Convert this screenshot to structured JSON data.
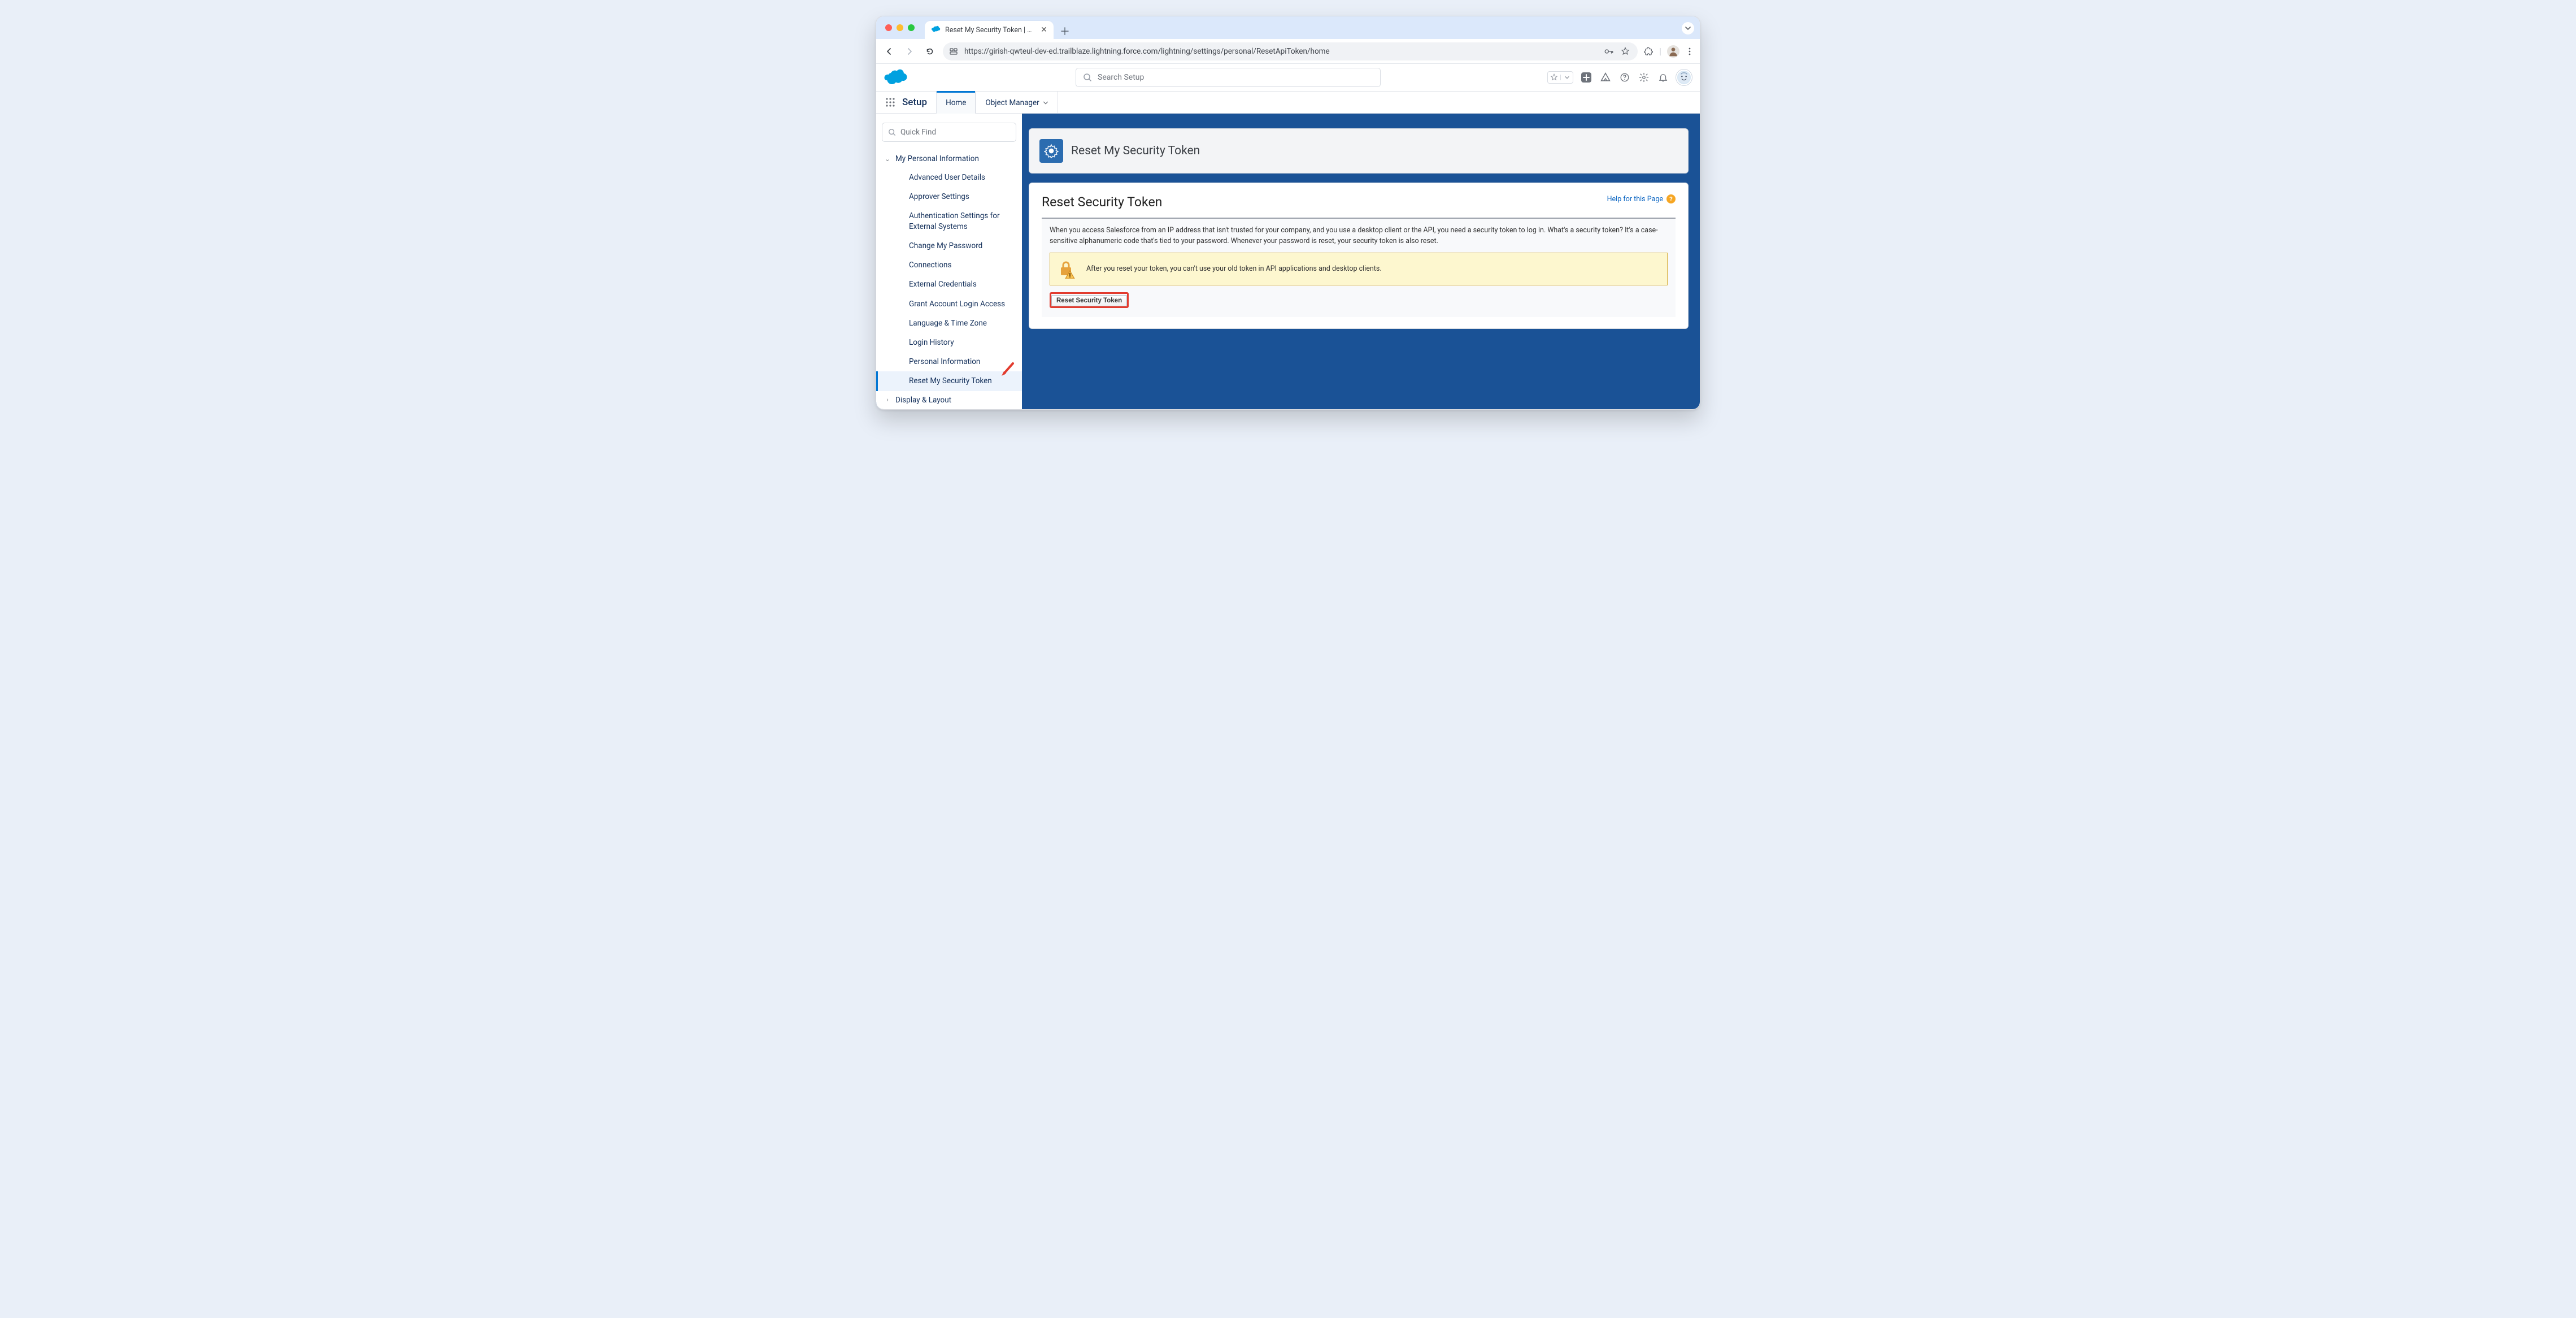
{
  "browser": {
    "tab_title": "Reset My Security Token | Sal",
    "url": "https://girish-qwteul-dev-ed.trailblaze.lightning.force.com/lightning/settings/personal/ResetApiToken/home"
  },
  "header": {
    "search_placeholder": "Search Setup"
  },
  "nav": {
    "app": "Setup",
    "tab_home": "Home",
    "tab_object_manager": "Object Manager"
  },
  "sidebar": {
    "quickfind_placeholder": "Quick Find",
    "section1": "My Personal Information",
    "items": [
      "Advanced User Details",
      "Approver Settings",
      "Authentication Settings for External Systems",
      "Change My Password",
      "Connections",
      "External Credentials",
      "Grant Account Login Access",
      "Language & Time Zone",
      "Login History",
      "Personal Information",
      "Reset My Security Token"
    ],
    "section2": "Display & Layout"
  },
  "page": {
    "header_title": "Reset My Security Token",
    "panel_title": "Reset Security Token",
    "help_label": "Help for this Page",
    "description": "When you access Salesforce from an IP address that isn't trusted for your company, and you use a desktop client or the API, you need a security token to log in. What's a security token? It's a case-sensitive alphanumeric code that's tied to your password. Whenever your password is reset, your security token is also reset.",
    "warning": "After you reset your token, you can't use your old token in API applications and desktop clients.",
    "button_label": "Reset Security Token"
  }
}
